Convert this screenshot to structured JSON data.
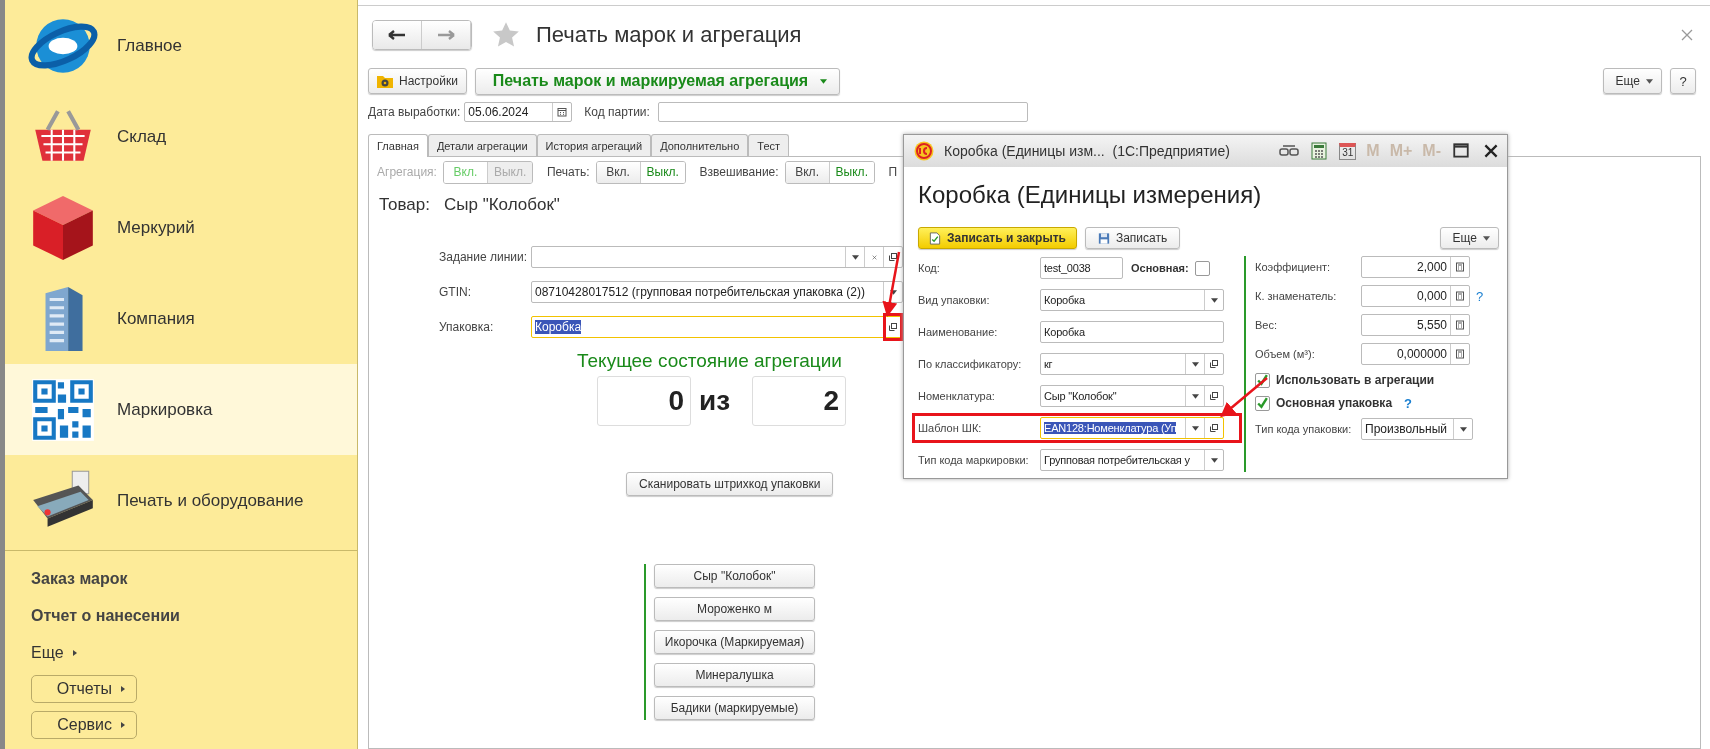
{
  "sidebar": {
    "sections": [
      {
        "label": "Главное",
        "selected": false
      },
      {
        "label": "Склад",
        "selected": false
      },
      {
        "label": "Меркурий",
        "selected": false
      },
      {
        "label": "Компания",
        "selected": false
      },
      {
        "label": "Маркировка",
        "selected": true
      },
      {
        "label": "Печать и оборудование",
        "selected": false
      }
    ],
    "links": [
      "Заказ марок",
      "Отчет о нанесении"
    ],
    "more": "Еще",
    "groups": [
      "Отчеты",
      "Сервис"
    ]
  },
  "main": {
    "title": "Печать марок и агрегация",
    "settings_button": "Настройки",
    "command_button": "Печать марок и маркируемая агрегация",
    "more_button": "Еще",
    "help_button": "?",
    "date_label": "Дата выработки:",
    "date_value": "05.06.2024",
    "batch_label": "Код партии:",
    "tabs": [
      {
        "label": "Главная",
        "selected": true
      },
      {
        "label": "Детали агрегации",
        "selected": false
      },
      {
        "label": "История агрегаций",
        "selected": false
      },
      {
        "label": "Дополнительно",
        "selected": false
      },
      {
        "label": "Тест",
        "selected": false
      }
    ],
    "toggles": [
      {
        "label": "Агрегация:",
        "disabled": true,
        "options": [
          {
            "label": "Вкл.",
            "selected": true
          },
          {
            "label": "Выкл.",
            "selected": false
          }
        ]
      },
      {
        "label": "Печать:",
        "disabled": false,
        "options": [
          {
            "label": "Вкл.",
            "selected": false
          },
          {
            "label": "Выкл.",
            "selected": true
          }
        ]
      },
      {
        "label": "Взвешивание:",
        "disabled": false,
        "options": [
          {
            "label": "Вкл.",
            "selected": false
          },
          {
            "label": "Выкл.",
            "selected": true
          }
        ]
      }
    ],
    "cut_label": "П",
    "product_label": "Товар:",
    "product": "Сыр \"Колобок\"",
    "fields": [
      {
        "label": "Задание линии:",
        "kind": "task",
        "focused": false,
        "highlighted": false
      },
      {
        "label": "GTIN:",
        "value": "08710428017512 (групповая потребительская упаковка (2))",
        "kind": "select",
        "focused": false,
        "highlighted": false
      },
      {
        "label": "Упаковка:",
        "value": "Коробка",
        "kind": "reference",
        "focused": true,
        "highlighted": true
      }
    ],
    "status_title": "Текущее состояние агрегации",
    "counter_current": "0",
    "counter_separator": "из",
    "counter_total": "2",
    "scan_button": "Сканировать штрихкод упаковки",
    "products": [
      "Сыр \"Колобок\"",
      "Мороженко м",
      "Икорочка (Маркируемая)",
      "Минералушка",
      "Бадики (маркируемые)"
    ]
  },
  "dialog": {
    "title": "Коробка (Единицы изм...  (1С:Предприятие)",
    "calendar_day": "31",
    "memory_buttons": [
      "M",
      "M+",
      "M-"
    ],
    "heading": "Коробка (Единицы измерения)",
    "save_close_button": "Записать и закрыть",
    "save_button": "Записать",
    "more_button": "Еще",
    "left_fields": [
      {
        "label": "Код:",
        "value": "test_0038",
        "kind": "text",
        "focused": false,
        "highlighted": false,
        "check_label": "Основная:",
        "checked": false
      },
      {
        "label": "Вид упаковки:",
        "value": "Коробка",
        "kind": "select",
        "focused": false,
        "highlighted": false
      },
      {
        "label": "Наименование:",
        "value": "Коробка",
        "kind": "text",
        "focused": false,
        "highlighted": false
      },
      {
        "label": "По классификатору:",
        "value": "кг",
        "kind": "lookup",
        "focused": false,
        "highlighted": false
      },
      {
        "label": "Номенклатура:",
        "value": "Сыр \"Колобок\"",
        "kind": "lookup",
        "focused": false,
        "highlighted": false
      },
      {
        "label": "Шаблон ШК:",
        "value": "EAN128:Номенклатура (Уп",
        "kind": "lookup",
        "focused": true,
        "highlighted": true
      },
      {
        "label": "Тип кода маркировки:",
        "value": "Групповая потребительская у",
        "kind": "select",
        "focused": false,
        "highlighted": false
      }
    ],
    "right_fields": [
      {
        "label": "Коэффициент:",
        "value": "2,000",
        "help": false
      },
      {
        "label": "К. знаменатель:",
        "value": "0,000",
        "help": true
      },
      {
        "label": "Вес:",
        "value": "5,550",
        "help": false
      },
      {
        "label": "Объем (м³):",
        "value": "0,000000",
        "help": false
      }
    ],
    "checks": [
      {
        "label": "Использовать в агрегации",
        "checked": true,
        "help": false
      },
      {
        "label": "Основная упаковка",
        "checked": true,
        "help": true
      }
    ],
    "help_mark": "?",
    "package_code_label": "Тип кода упаковки:",
    "package_code_value": "Произвольный"
  }
}
